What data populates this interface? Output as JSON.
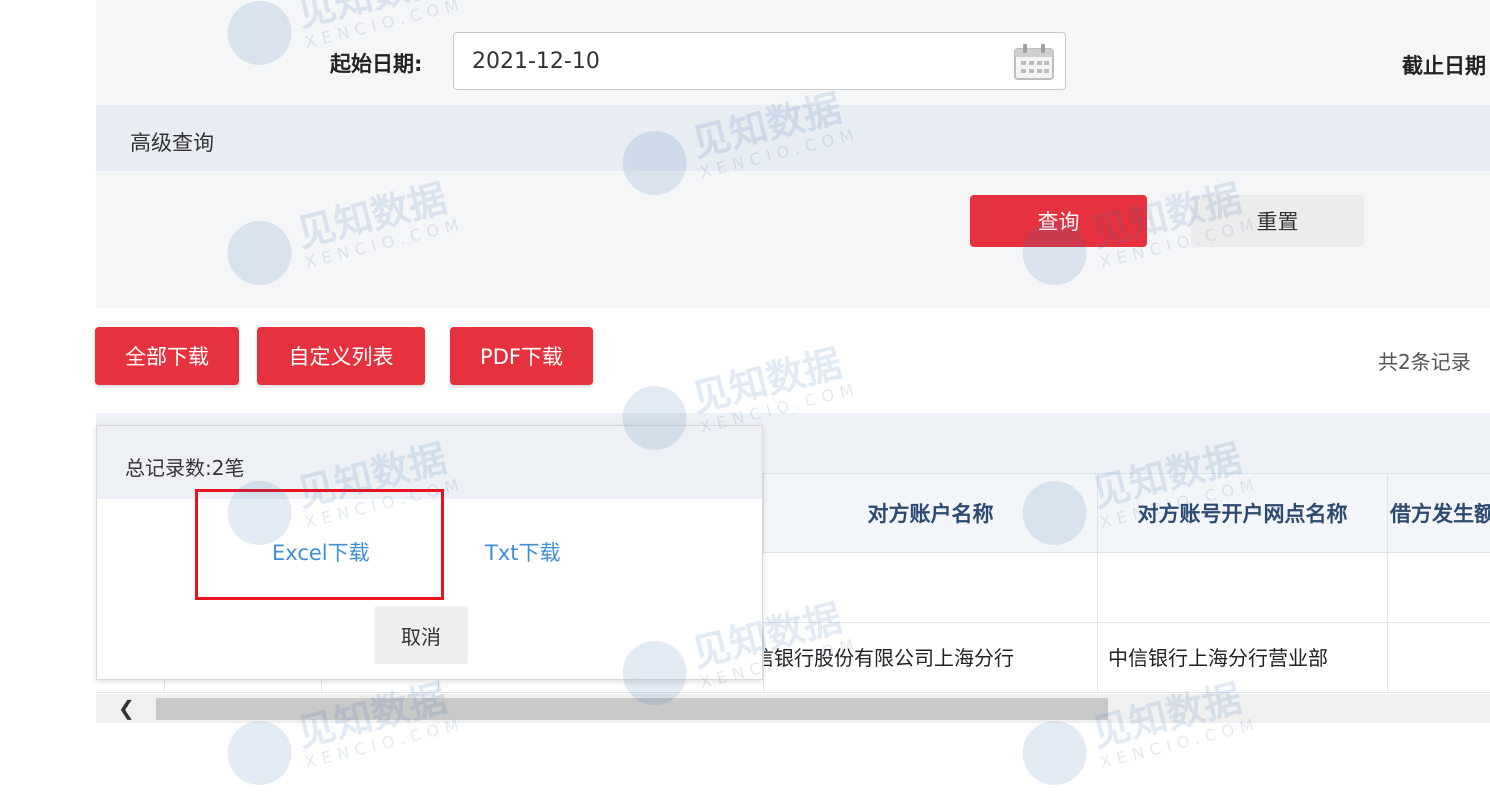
{
  "filter": {
    "start_date_label": "起始日期:",
    "start_date_value": "2021-12-10",
    "end_date_label": "截止日期",
    "advanced_title": "高级查询",
    "query_label": "查询",
    "reset_label": "重置"
  },
  "toolbar": {
    "download_all_label": "全部下载",
    "custom_columns_label": "自定义列表",
    "pdf_download_label": "PDF下载",
    "record_count_text": "共2条记录"
  },
  "table": {
    "headers": [
      "对方账户名称",
      "对方账号开户网点名称",
      "借方发生额"
    ],
    "row": {
      "counterparty_name": "中信银行股份有限公司上海分行",
      "branch_name": "中信银行上海分行营业部"
    }
  },
  "popup": {
    "title": "总记录数:2笔",
    "excel_label": "Excel下载",
    "txt_label": "Txt下载",
    "cancel_label": "取消"
  },
  "watermark": {
    "cn": "见知数据",
    "en": "XENCIO.COM"
  },
  "colors": {
    "primary_red": "#e6323e",
    "link_blue": "#3f8fd6",
    "header_text": "#2d4a70",
    "highlight_red": "#e8131f"
  }
}
